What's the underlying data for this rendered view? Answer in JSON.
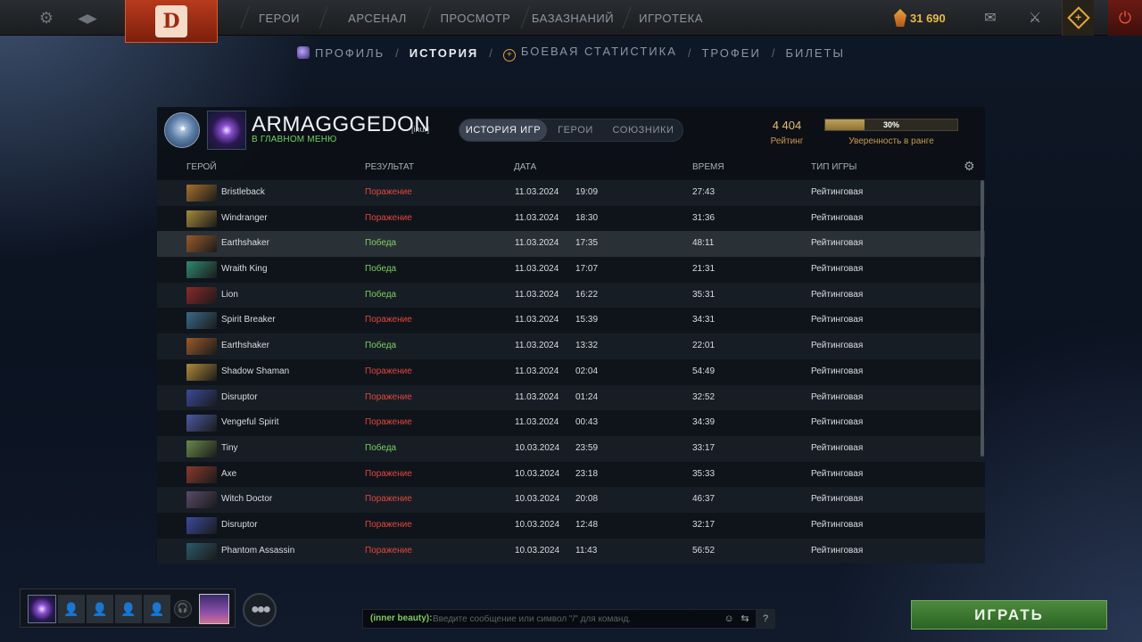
{
  "topnav": {
    "items": [
      "ГЕРОИ",
      "АРСЕНАЛ",
      "ПРОСМОТР",
      "БАЗАЗНАНИЙ",
      "ИГРОТЕКА"
    ],
    "currency": "31 690",
    "accent": "#b83a1c"
  },
  "subnav": {
    "profile": "ПРОФИЛЬ",
    "history": "ИСТОРИЯ",
    "stats": "БОЕВАЯ СТАТИСТИКА",
    "trophies": "ТРОФЕИ",
    "tickets": "БИЛЕТЫ",
    "sep": "/"
  },
  "profile": {
    "name": "ARMAGGGEDON",
    "clan_tag": "[inur]",
    "status": "В ГЛАВНОМ МЕНЮ",
    "rating": "4 404",
    "rating_label": "Рейтинг",
    "confidence": "30%",
    "confidence_value": 0.3,
    "confidence_label": "Уверенность в ранге"
  },
  "tabs": [
    "ИСТОРИЯ ИГР",
    "ГЕРОИ",
    "СОЮЗНИКИ"
  ],
  "columns": {
    "hero": "ГЕРОЙ",
    "result": "РЕЗУЛЬТАТ",
    "date": "ДАТА",
    "duration": "ВРЕМЯ",
    "type": "ТИП ИГРЫ"
  },
  "matches": [
    {
      "hero": "Bristleback",
      "result": "Поражение",
      "win": false,
      "date": "11.03.2024",
      "time": "19:09",
      "duration": "27:43",
      "type": "Рейтинговая",
      "color": "#a5702c"
    },
    {
      "hero": "Windranger",
      "result": "Поражение",
      "win": false,
      "date": "11.03.2024",
      "time": "18:30",
      "duration": "31:36",
      "type": "Рейтинговая",
      "color": "#a68a3a"
    },
    {
      "hero": "Earthshaker",
      "result": "Победа",
      "win": true,
      "date": "11.03.2024",
      "time": "17:35",
      "duration": "48:11",
      "type": "Рейтинговая",
      "color": "#9a5a2a"
    },
    {
      "hero": "Wraith King",
      "result": "Победа",
      "win": true,
      "date": "11.03.2024",
      "time": "17:07",
      "duration": "21:31",
      "type": "Рейтинговая",
      "color": "#2f8a6e"
    },
    {
      "hero": "Lion",
      "result": "Победа",
      "win": true,
      "date": "11.03.2024",
      "time": "16:22",
      "duration": "35:31",
      "type": "Рейтинговая",
      "color": "#8a2a2a"
    },
    {
      "hero": "Spirit Breaker",
      "result": "Поражение",
      "win": false,
      "date": "11.03.2024",
      "time": "15:39",
      "duration": "34:31",
      "type": "Рейтинговая",
      "color": "#3a6a8a"
    },
    {
      "hero": "Earthshaker",
      "result": "Победа",
      "win": true,
      "date": "11.03.2024",
      "time": "13:32",
      "duration": "22:01",
      "type": "Рейтинговая",
      "color": "#9a5a2a"
    },
    {
      "hero": "Shadow Shaman",
      "result": "Поражение",
      "win": false,
      "date": "11.03.2024",
      "time": "02:04",
      "duration": "54:49",
      "type": "Рейтинговая",
      "color": "#b08a3a"
    },
    {
      "hero": "Disruptor",
      "result": "Поражение",
      "win": false,
      "date": "11.03.2024",
      "time": "01:24",
      "duration": "32:52",
      "type": "Рейтинговая",
      "color": "#3a4a9a"
    },
    {
      "hero": "Vengeful Spirit",
      "result": "Поражение",
      "win": false,
      "date": "11.03.2024",
      "time": "00:43",
      "duration": "34:39",
      "type": "Рейтинговая",
      "color": "#4a5aa0"
    },
    {
      "hero": "Tiny",
      "result": "Победа",
      "win": true,
      "date": "10.03.2024",
      "time": "23:59",
      "duration": "33:17",
      "type": "Рейтинговая",
      "color": "#6a8a4a"
    },
    {
      "hero": "Axe",
      "result": "Поражение",
      "win": false,
      "date": "10.03.2024",
      "time": "23:18",
      "duration": "35:33",
      "type": "Рейтинговая",
      "color": "#8a3a2a"
    },
    {
      "hero": "Witch Doctor",
      "result": "Поражение",
      "win": false,
      "date": "10.03.2024",
      "time": "20:08",
      "duration": "46:37",
      "type": "Рейтинговая",
      "color": "#5a4a6a"
    },
    {
      "hero": "Disruptor",
      "result": "Поражение",
      "win": false,
      "date": "10.03.2024",
      "time": "12:48",
      "duration": "32:17",
      "type": "Рейтинговая",
      "color": "#3a4a9a"
    },
    {
      "hero": "Phantom Assassin",
      "result": "Поражение",
      "win": false,
      "date": "10.03.2024",
      "time": "11:43",
      "duration": "56:52",
      "type": "Рейтинговая",
      "color": "#2a5a6a"
    }
  ],
  "chat": {
    "label": "(inner beauty):",
    "placeholder": "Введите сообщение или символ \"/\" для команд.",
    "help": "?"
  },
  "play_label": "ИГРАТЬ",
  "colors": {
    "win": "#7ad15e",
    "loss": "#e2473c",
    "gold": "#e3bd72"
  }
}
